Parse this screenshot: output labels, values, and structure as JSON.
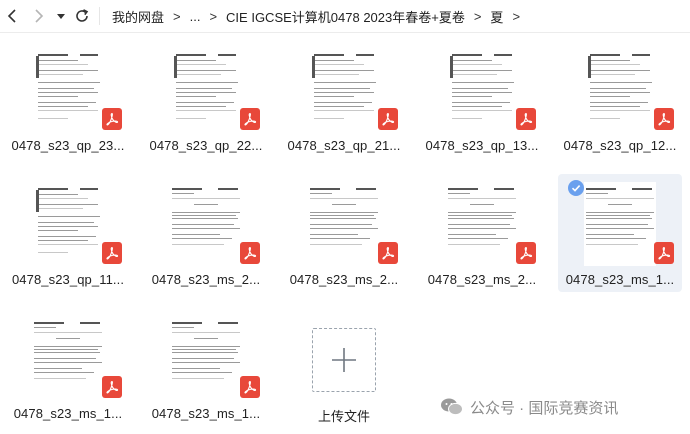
{
  "nav": {
    "back_icon": "chevron-left-icon",
    "forward_icon": "chevron-right-icon",
    "dropdown_icon": "caret-down-icon",
    "refresh_icon": "refresh-icon"
  },
  "breadcrumb": [
    {
      "label": "我的网盘"
    },
    {
      "label": "..."
    },
    {
      "label": "CIE IGCSE计算机0478 2023年春卷+夏卷"
    },
    {
      "label": "夏"
    }
  ],
  "files": [
    {
      "name": "0478_s23_qp_23...",
      "kind": "qp",
      "selected": false
    },
    {
      "name": "0478_s23_qp_22...",
      "kind": "qp",
      "selected": false
    },
    {
      "name": "0478_s23_qp_21...",
      "kind": "qp",
      "selected": false
    },
    {
      "name": "0478_s23_qp_13...",
      "kind": "qp",
      "selected": false
    },
    {
      "name": "0478_s23_qp_12...",
      "kind": "qp",
      "selected": false
    },
    {
      "name": "0478_s23_qp_11...",
      "kind": "qp",
      "selected": false
    },
    {
      "name": "0478_s23_ms_2...",
      "kind": "ms",
      "selected": false
    },
    {
      "name": "0478_s23_ms_2...",
      "kind": "ms",
      "selected": false
    },
    {
      "name": "0478_s23_ms_2...",
      "kind": "ms",
      "selected": false
    },
    {
      "name": "0478_s23_ms_1...",
      "kind": "ms",
      "selected": true
    },
    {
      "name": "0478_s23_ms_1...",
      "kind": "ms",
      "selected": false
    },
    {
      "name": "0478_s23_ms_1...",
      "kind": "ms",
      "selected": false
    }
  ],
  "upload": {
    "label": "上传文件",
    "icon": "plus-icon"
  },
  "watermark": {
    "text": "公众号 · 国际竞赛资讯",
    "icon": "wechat-icon"
  },
  "colors": {
    "pdf_badge": "#e8483a",
    "selection": "#edf1f7",
    "check": "#6aa0ee"
  }
}
